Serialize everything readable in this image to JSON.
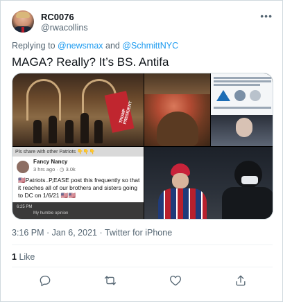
{
  "tweet": {
    "display_name": "RC0076",
    "handle": "@rwacollins",
    "reply_prefix": "Replying to",
    "reply_to_1": "@newsmax",
    "reply_joiner": "and",
    "reply_to_2": "@SchmittNYC",
    "text": "MAGA? Really? It’s BS. Antifa",
    "timestamp": "3:16 PM · Jan 6, 2021 · Twitter for iPhone",
    "like_count": "1",
    "like_label": "Like"
  },
  "media": {
    "share_note": "Pls share with other Patriots",
    "share_emoji": "👇👇👇",
    "post_name": "Fancy Nancy",
    "post_meta": "3 hrs ago · ◷ 3.0k",
    "post_body": "🇺🇸Patriots..P,EASE post this frequently so that it reaches all of our brothers and sisters going to DC on 1/6/21 🇺🇸🇺🇸",
    "phone_status": "6:25 PM",
    "comment_line": "My humble opinion",
    "flag_text": "TRUMP PRESIDENT"
  },
  "icons": {
    "more": "more-dots-icon",
    "reply": "reply-icon",
    "retweet": "retweet-icon",
    "like": "heart-icon",
    "share": "share-icon"
  },
  "colors": {
    "link": "#1d9bf0",
    "secondary_text": "#536471",
    "border": "#cfd9de"
  }
}
